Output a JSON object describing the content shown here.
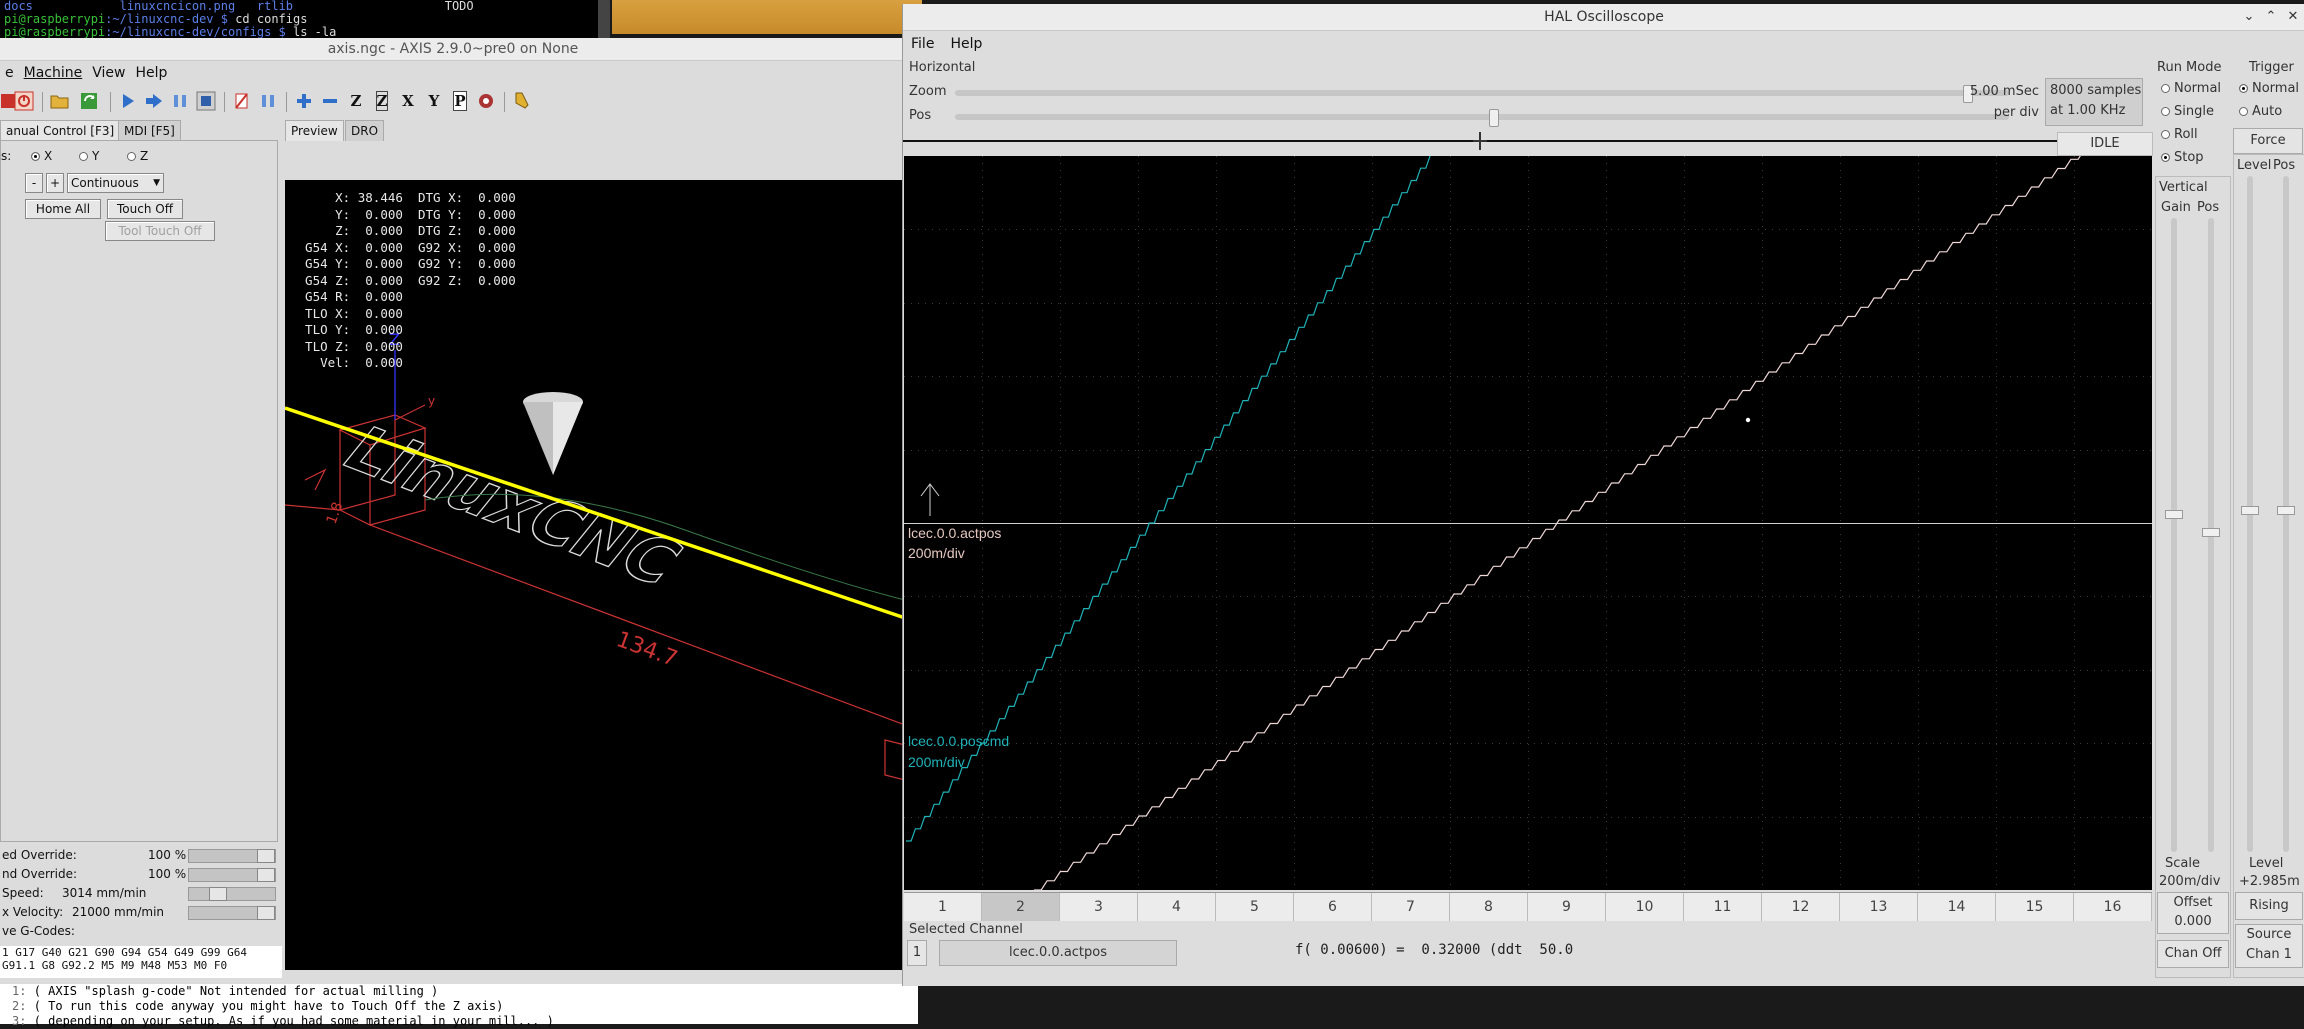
{
  "terminal": {
    "line1": {
      "col1": "docs",
      "col2": "linuxcncicon.png",
      "col3": "rtlib",
      "col4": "TODO"
    },
    "line2": {
      "prompt": "pi@raspberrypi",
      "path": ":~/linuxcnc-dev $",
      "cmd": " cd configs"
    },
    "line3": {
      "prompt": "pi@raspberrypi",
      "path": ":~/linuxcnc-dev/configs $",
      "cmd": " ls -la"
    }
  },
  "axis": {
    "title": "axis.ngc - AXIS 2.9.0~pre0 on None",
    "menu": [
      "e",
      "Machine",
      "View",
      "Help"
    ],
    "tabs_left": [
      "anual Control [F3]",
      "MDI [F5]"
    ],
    "tabs_right": [
      "Preview",
      "DRO"
    ],
    "axis_label": "s:",
    "axis_radios": [
      "X",
      "Y",
      "Z"
    ],
    "jog_minus": "-",
    "jog_plus": "+",
    "jog_mode": "Continuous",
    "home_all": "Home All",
    "touch_off": "Touch Off",
    "tool_touch_off": "Tool Touch Off",
    "overrides": [
      {
        "label": "ed Override:",
        "value": "100 %",
        "level": 1.0
      },
      {
        "label": "nd Override:",
        "value": "100 %",
        "level": 1.0
      },
      {
        "label": "Speed:",
        "value": "3014 mm/min",
        "level": 0.3
      },
      {
        "label": "x Velocity:",
        "value": "21000 mm/min",
        "level": 1.0
      }
    ],
    "active_gcodes_label": "ve G-Codes:",
    "gcodes_line1": "1 G17 G40 G21 G90 G94 G54 G49 G99 G64",
    "gcodes_line2": "G91.1 G8 G92.2 M5 M9 M48 M53 M0 F0",
    "dro": [
      {
        "a": "      X:",
        "av": " 38.446",
        "b": "DTG X:",
        "bv": "  0.000"
      },
      {
        "a": "      Y:",
        "av": "  0.000",
        "b": "DTG Y:",
        "bv": "  0.000"
      },
      {
        "a": "      Z:",
        "av": "  0.000",
        "b": "DTG Z:",
        "bv": "  0.000"
      },
      {
        "a": "  G54 X:",
        "av": "  0.000",
        "b": "G92 X:",
        "bv": "  0.000"
      },
      {
        "a": "  G54 Y:",
        "av": "  0.000",
        "b": "G92 Y:",
        "bv": "  0.000"
      },
      {
        "a": "  G54 Z:",
        "av": "  0.000",
        "b": "G92 Z:",
        "bv": "  0.000"
      },
      {
        "a": "  G54 R:",
        "av": "  0.000",
        "b": "",
        "bv": ""
      },
      {
        "a": "  TLO X:",
        "av": "  0.000",
        "b": "",
        "bv": ""
      },
      {
        "a": "  TLO Y:",
        "av": "  0.000",
        "b": "",
        "bv": ""
      },
      {
        "a": "  TLO Z:",
        "av": "  0.000",
        "b": "",
        "bv": ""
      },
      {
        "a": "    Vel:",
        "av": "  0.000",
        "b": "",
        "bv": ""
      }
    ],
    "preview_texts": {
      "dim": "134.7",
      "dim2": "1.8",
      "axis_z": "Z",
      "axis_y": "y",
      "brand": "LinuxCNC"
    },
    "program_lines": [
      {
        "n": "1:",
        "text": "( AXIS \"splash g-code\" Not intended for actual milling )"
      },
      {
        "n": "2:",
        "text": "( To run this code anyway you might have to Touch Off the Z axis)"
      },
      {
        "n": "3:",
        "text": "( depending on your setup. As if you had some material in your mill... )"
      }
    ]
  },
  "hal": {
    "title": "HAL Oscilloscope",
    "menu": [
      "File",
      "Help"
    ],
    "horizontal_label": "Horizontal",
    "zoom_label": "Zoom",
    "pos_label": "Pos",
    "zoom_level": 0.96,
    "pos_level": 0.51,
    "time_div": "5.00 mSec",
    "per_div": "per div",
    "samples": "8000 samples",
    "rate": "at 1.00 KHz",
    "status": "IDLE",
    "run_mode_label": "Run Mode",
    "run_modes": [
      "Normal",
      "Single",
      "Roll",
      "Stop"
    ],
    "run_mode_selected": "Stop",
    "trigger_label": "Trigger",
    "trigger_modes": [
      "Normal",
      "Auto"
    ],
    "force": "Force",
    "vertical_label": "Vertical",
    "gain_label": "Gain",
    "vpos_label": "Pos",
    "level_label": "Level",
    "tpos_label": "Pos",
    "scale_label": "Scale",
    "scale_value": "200m/div",
    "offset_label": "Offset",
    "offset_value": "0.000",
    "chan_off": "Chan Off",
    "level_caption": "Level",
    "level_value": "+2.985m",
    "rising": "Rising",
    "source_label": "Source",
    "source_value": "Chan 1",
    "channels": [
      "1",
      "2",
      "3",
      "4",
      "5",
      "6",
      "7",
      "8",
      "9",
      "10",
      "11",
      "12",
      "13",
      "14",
      "15",
      "16"
    ],
    "selected_channel_index": 1,
    "selected_channel_label": "Selected Channel",
    "selected_channel_num": "1",
    "selected_channel_name": "lcec.0.0.actpos",
    "readout": "f( 0.00600) =  0.32000 (ddt  50.0",
    "trace1_name": "lcec.0.0.actpos",
    "trace1_scale": "200m/div",
    "trace1_color": "#f0d8d8",
    "trace2_name": "lcec.0.0.poscmd",
    "trace2_scale": "200m/div",
    "trace2_color": "#1fb3b8"
  }
}
